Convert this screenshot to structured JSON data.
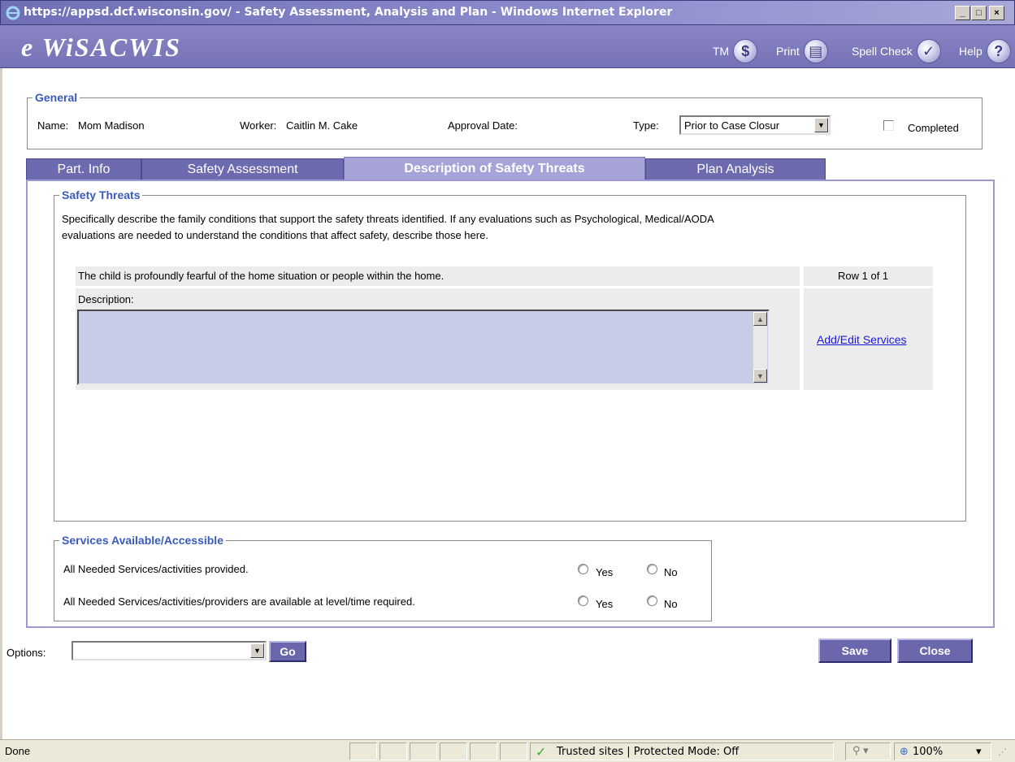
{
  "window": {
    "title": "https://appsd.dcf.wisconsin.gov/ - Safety Assessment, Analysis and Plan - Windows Internet Explorer",
    "controls": [
      "_",
      "□",
      "×"
    ]
  },
  "banner": {
    "brand": "e WiSACWIS",
    "toolbar": [
      {
        "label": "TM",
        "icon": "tm-icon"
      },
      {
        "label": "Print",
        "icon": "print-icon"
      },
      {
        "label": "Spell Check",
        "icon": "spell-check-icon"
      },
      {
        "label": "Help",
        "icon": "help-icon"
      }
    ]
  },
  "general": {
    "legend": "General",
    "name_label": "Name:",
    "name_value": "Mom Madison",
    "worker_label": "Worker:",
    "worker_value": "Caitlin M. Cake",
    "approval_label": "Approval Date:",
    "approval_value": "",
    "type_label": "Type:",
    "type_value": "Prior to Case Closur",
    "completed_label": "Completed",
    "completed_checked": false
  },
  "tabs": [
    {
      "label": "Part. Info",
      "active": false
    },
    {
      "label": "Safety Assessment",
      "active": false
    },
    {
      "label": "Description of Safety Threats",
      "active": true
    },
    {
      "label": "Plan Analysis",
      "active": false
    }
  ],
  "safety_threats": {
    "legend": "Safety Threats",
    "instructions_line1": "Specifically describe the family conditions that support the safety threats identified. If any evaluations such as Psychological, Medical/AODA",
    "instructions_line2": "evaluations are needed to understand the conditions that affect safety, describe those here.",
    "threat_text": "The child is profoundly fearful of the home situation or people within the home.",
    "row_indicator": "Row 1 of 1",
    "description_label": "Description:",
    "description_value": "",
    "add_edit_link": "Add/Edit Services"
  },
  "services": {
    "legend": "Services Available/Accessible",
    "questions": [
      {
        "text": "All Needed Services/activities provided.",
        "yes": "Yes",
        "no": "No"
      },
      {
        "text": "All Needed Services/activities/providers are available at level/time required.",
        "yes": "Yes",
        "no": "No"
      }
    ]
  },
  "footer": {
    "options_label": "Options:",
    "options_value": "",
    "go_label": "Go",
    "save_label": "Save",
    "close_label": "Close"
  },
  "statusbar": {
    "status": "Done",
    "zone": "Trusted sites | Protected Mode: Off",
    "zoom": "100%"
  }
}
